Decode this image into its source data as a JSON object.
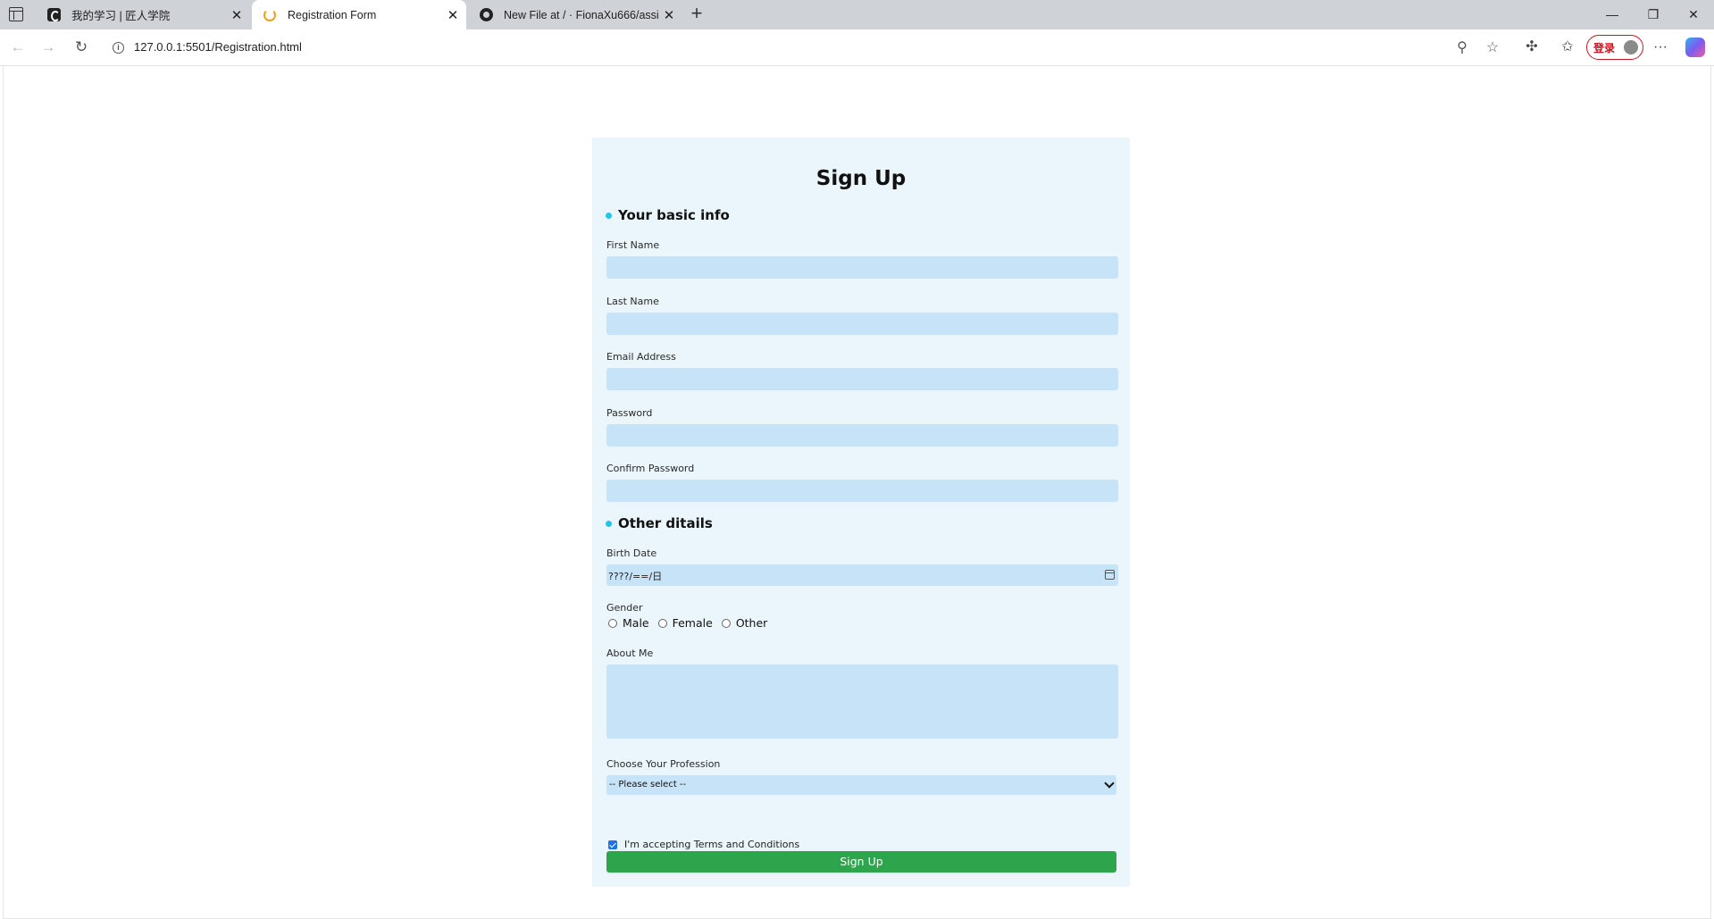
{
  "browser": {
    "tabs": [
      {
        "title": "我的学习 | 匠人学院",
        "icon": "site-logo-icon"
      },
      {
        "title": "Registration Form",
        "icon": "loading-ring-icon"
      },
      {
        "title": "New File at / · FionaXu666/assing",
        "icon": "github-icon"
      }
    ],
    "new_tab": "+",
    "close_glyph": "✕",
    "window": {
      "minimize": "—",
      "restore": "❐",
      "close": "✕"
    },
    "url": "127.0.0.1:5501/Registration.html",
    "login_label": "登录"
  },
  "form": {
    "title": "Sign Up",
    "section_basic": "Your basic info",
    "first_name_label": "First Name",
    "last_name_label": "Last Name",
    "email_label": "Email Address",
    "password_label": "Password",
    "confirm_password_label": "Confirm Password",
    "section_other": "Other ditails",
    "birth_date_label": "Birth Date",
    "birth_date_placeholder": "????/==/日",
    "gender_label": "Gender",
    "gender_options": [
      "Male",
      "Female",
      "Other"
    ],
    "about_label": "About Me",
    "profession_label": "Choose Your Profession",
    "profession_selected": "-- Please select --",
    "terms_label": "I'm accepting Terms and Conditions",
    "terms_checked": true,
    "submit_label": "Sign Up"
  },
  "colors": {
    "card_bg": "#eaf6fb",
    "input_bg": "#c7e3f7",
    "section_dot": "#22c6e6",
    "submit_bg": "#2ea54d"
  }
}
